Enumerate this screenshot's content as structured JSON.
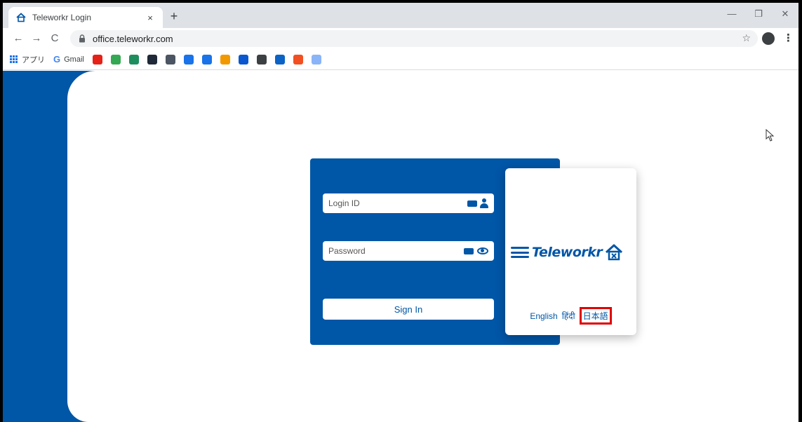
{
  "browser": {
    "tab_title": "Teleworkr Login",
    "tab_close": "×",
    "new_tab": "+",
    "minimize": "—",
    "restore": "❐",
    "close": "✕",
    "back": "←",
    "forward": "→",
    "reload": "C",
    "url": "office.teleworkr.com",
    "star": "☆",
    "menu": "⋮"
  },
  "bookmarks": {
    "apps_label": "アプリ",
    "gmail_label": "Gmail",
    "icons": [
      {
        "name": "youtube-icon",
        "color": "#e62117"
      },
      {
        "name": "photos-icon",
        "color": "#34a853"
      },
      {
        "name": "app-icon-1",
        "color": "#1e8e5e"
      },
      {
        "name": "app-icon-2",
        "color": "#1f2937"
      },
      {
        "name": "app-icon-3",
        "color": "#4b5563"
      },
      {
        "name": "app-icon-4",
        "color": "#1a73e8"
      },
      {
        "name": "app-icon-5",
        "color": "#1a73e8"
      },
      {
        "name": "app-icon-6",
        "color": "#f29900"
      },
      {
        "name": "app-icon-7",
        "color": "#0b57d0"
      },
      {
        "name": "app-icon-8",
        "color": "#3c4043"
      },
      {
        "name": "cloud-icon",
        "color": "#0b63c5"
      },
      {
        "name": "windows-icon",
        "color": "#f25022"
      },
      {
        "name": "app-icon-9",
        "color": "#8ab4f8"
      }
    ]
  },
  "login": {
    "login_id_placeholder": "Login ID",
    "password_placeholder": "Password",
    "signin_label": "Sign In",
    "logo_text": "Teleworkr",
    "languages": [
      "English",
      "हिंदी",
      "日本語"
    ],
    "selected_language_index": 2
  },
  "colors": {
    "brand_blue": "#0056a7",
    "highlight_red": "#e00000"
  }
}
